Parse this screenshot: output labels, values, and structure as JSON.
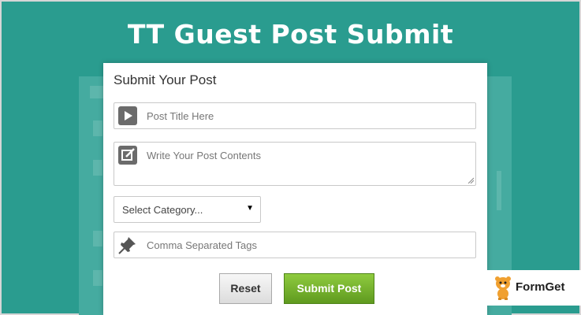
{
  "banner": {
    "title": "TT Guest Post Submit"
  },
  "form": {
    "title": "Submit Your Post",
    "post_title_placeholder": "Post Title Here",
    "post_content_placeholder": "Write Your Post Contents",
    "category_selected": "Select Category...",
    "tags_placeholder": "Comma Separated Tags",
    "reset_label": "Reset",
    "submit_label": "Submit Post"
  },
  "brand": {
    "name": "FormGet"
  },
  "colors": {
    "background": "#2a9c8f",
    "submit_button": "#6fae27",
    "icon_box": "#6b6b6b"
  },
  "icons": {
    "post_title": "play-icon",
    "post_content": "edit-icon",
    "tags": "pin-icon",
    "category": "caret-down-icon",
    "brand": "tiger-logo"
  }
}
